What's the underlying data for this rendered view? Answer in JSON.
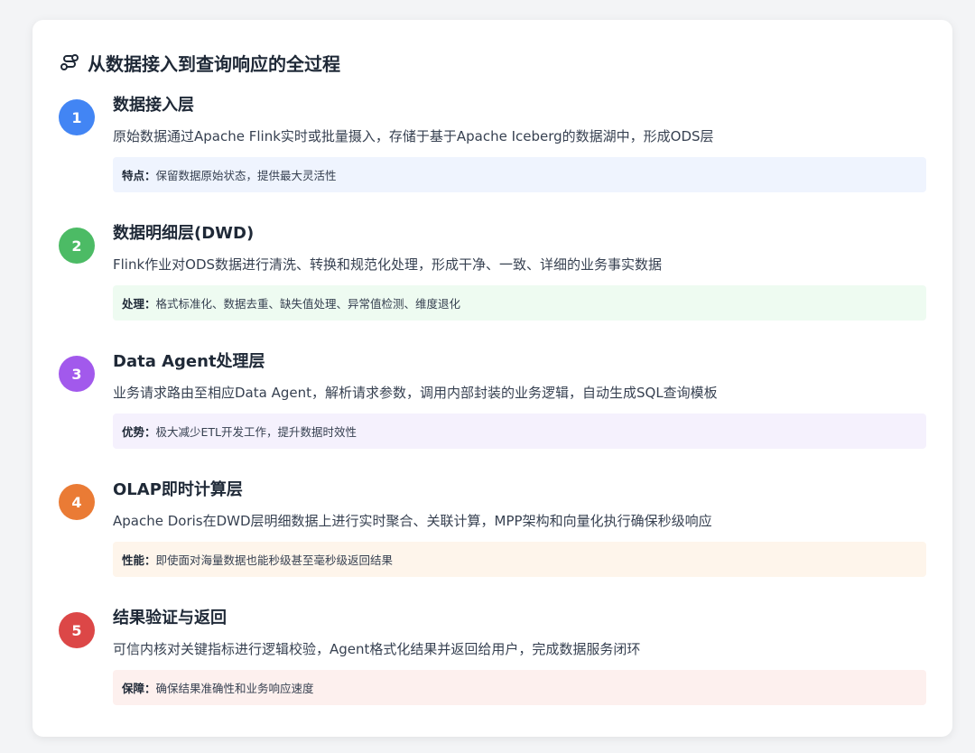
{
  "card": {
    "title": "从数据接入到查询响应的全过程",
    "title_icon": "route-icon"
  },
  "steps": [
    {
      "number": "1",
      "title": "数据接入层",
      "description": "原始数据通过Apache Flink实时或批量摄入，存储于基于Apache Iceberg的数据湖中，形成ODS层",
      "note_label": "特点：",
      "note_text": "保留数据原始状态，提供最大灵活性",
      "color": "#3b82f6",
      "note_bg": "#eff4fe"
    },
    {
      "number": "2",
      "title": "数据明细层(DWD)",
      "description": "Flink作业对ODS数据进行清洗、转换和规范化处理，形成干净、一致、详细的业务事实数据",
      "note_label": "处理：",
      "note_text": "格式标准化、数据去重、缺失值处理、异常值检测、维度退化",
      "color": "#22c55e",
      "note_bg": "#eefbf1"
    },
    {
      "number": "3",
      "title": "Data Agent处理层",
      "description": "业务请求路由至相应Data Agent，解析请求参数，调用内部封装的业务逻辑，自动生成SQL查询模板",
      "note_label": "优势：",
      "note_text": "极大减少ETL开发工作，提升数据时效性",
      "color": "#a855f7",
      "note_bg": "#f5f1fd"
    },
    {
      "number": "4",
      "title": "OLAP即时计算层",
      "description": "Apache Doris在DWD层明细数据上进行实时聚合、关联计算，MPP架构和向量化执行确保秒级响应",
      "note_label": "性能：",
      "note_text": "即使面对海量数据也能秒级甚至毫秒级返回结果",
      "color": "#f97316",
      "note_bg": "#fef5eb"
    },
    {
      "number": "5",
      "title": "结果验证与返回",
      "description": "可信内核对关键指标进行逻辑校验，Agent格式化结果并返回给用户，完成数据服务闭环",
      "note_label": "保障：",
      "note_text": "确保结果准确性和业务响应速度",
      "color": "#ef4444",
      "note_bg": "#fdf0ee"
    }
  ]
}
